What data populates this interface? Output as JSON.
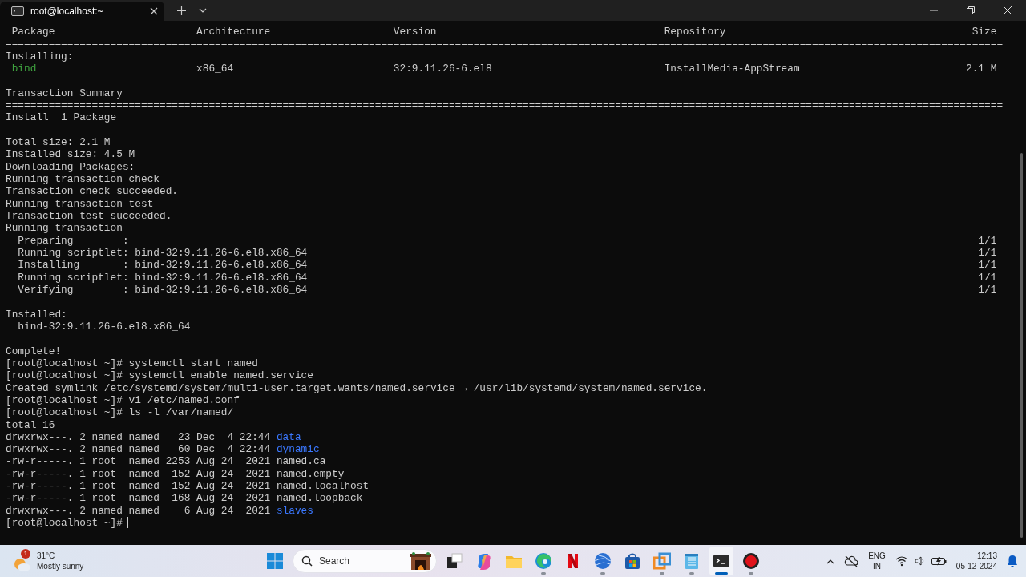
{
  "tabs": [
    {
      "title": "root@localhost:~",
      "selected": true
    }
  ],
  "terminal": {
    "lines": [
      {
        "kind": "table_header",
        "cells": [
          "Package",
          "Architecture",
          "Version",
          "Repository",
          "Size"
        ]
      },
      {
        "kind": "rule",
        "text": "=================================================================================================================================================================="
      },
      {
        "kind": "text",
        "text": "Installing:"
      },
      {
        "kind": "table_row",
        "cells": [
          "bind",
          "x86_64",
          "32:9.11.26-6.el8",
          "InstallMedia-AppStream",
          "2.1 M"
        ]
      },
      {
        "kind": "blank"
      },
      {
        "kind": "text",
        "text": "Transaction Summary"
      },
      {
        "kind": "rule",
        "text": "=================================================================================================================================================================="
      },
      {
        "kind": "text",
        "text": "Install  1 Package"
      },
      {
        "kind": "blank"
      },
      {
        "kind": "text",
        "text": "Total size: 2.1 M"
      },
      {
        "kind": "text",
        "text": "Installed size: 4.5 M"
      },
      {
        "kind": "text",
        "text": "Downloading Packages:"
      },
      {
        "kind": "text",
        "text": "Running transaction check"
      },
      {
        "kind": "text",
        "text": "Transaction check succeeded."
      },
      {
        "kind": "text",
        "text": "Running transaction test"
      },
      {
        "kind": "text",
        "text": "Transaction test succeeded."
      },
      {
        "kind": "text",
        "text": "Running transaction"
      },
      {
        "kind": "progress",
        "step": "Preparing        :",
        "count": "1/1"
      },
      {
        "kind": "progress",
        "step": "Running scriptlet: bind-32:9.11.26-6.el8.x86_64",
        "count": "1/1"
      },
      {
        "kind": "progress",
        "step": "Installing       : bind-32:9.11.26-6.el8.x86_64",
        "count": "1/1"
      },
      {
        "kind": "progress",
        "step": "Running scriptlet: bind-32:9.11.26-6.el8.x86_64",
        "count": "1/1"
      },
      {
        "kind": "progress",
        "step": "Verifying        : bind-32:9.11.26-6.el8.x86_64",
        "count": "1/1"
      },
      {
        "kind": "blank"
      },
      {
        "kind": "text",
        "text": "Installed:"
      },
      {
        "kind": "text",
        "text": "  bind-32:9.11.26-6.el8.x86_64"
      },
      {
        "kind": "blank"
      },
      {
        "kind": "text",
        "text": "Complete!"
      },
      {
        "kind": "prompt",
        "text": "[root@localhost ~]# systemctl start named"
      },
      {
        "kind": "prompt",
        "text": "[root@localhost ~]# systemctl enable named.service"
      },
      {
        "kind": "text",
        "text": "Created symlink /etc/systemd/system/multi-user.target.wants/named.service → /usr/lib/systemd/system/named.service."
      },
      {
        "kind": "prompt",
        "text": "[root@localhost ~]# vi /etc/named.conf"
      },
      {
        "kind": "prompt",
        "text": "[root@localhost ~]# ls -l /var/named/"
      },
      {
        "kind": "text",
        "text": "total 16"
      },
      {
        "kind": "ls",
        "details": "drwxrwx---. 2 named named   23 Dec  4 22:44",
        "name": "data",
        "directory": true
      },
      {
        "kind": "ls",
        "details": "drwxrwx---. 2 named named   60 Dec  4 22:44",
        "name": "dynamic",
        "directory": true
      },
      {
        "kind": "ls",
        "details": "-rw-r-----. 1 root  named 2253 Aug 24  2021",
        "name": "named.ca",
        "directory": false
      },
      {
        "kind": "ls",
        "details": "-rw-r-----. 1 root  named  152 Aug 24  2021",
        "name": "named.empty",
        "directory": false
      },
      {
        "kind": "ls",
        "details": "-rw-r-----. 1 root  named  152 Aug 24  2021",
        "name": "named.localhost",
        "directory": false
      },
      {
        "kind": "ls",
        "details": "-rw-r-----. 1 root  named  168 Aug 24  2021",
        "name": "named.loopback",
        "directory": false
      },
      {
        "kind": "ls",
        "details": "drwxrwx---. 2 named named    6 Aug 24  2021",
        "name": "slaves",
        "directory": true
      },
      {
        "kind": "prompt",
        "text": "[root@localhost ~]#",
        "cursor": true
      }
    ]
  },
  "taskbar": {
    "weather": {
      "badge": "1",
      "temperature": "31°C",
      "condition": "Mostly sunny"
    },
    "search": {
      "placeholder": "Search"
    },
    "apps": [
      {
        "kind": "taskview",
        "running": false,
        "selected": false
      },
      {
        "kind": "copilot",
        "running": false,
        "selected": false
      },
      {
        "kind": "folder",
        "running": false,
        "selected": false
      },
      {
        "kind": "edge",
        "running": true,
        "selected": false
      },
      {
        "kind": "netflix",
        "running": false,
        "selected": false
      },
      {
        "kind": "globe",
        "running": true,
        "selected": false
      },
      {
        "kind": "store",
        "running": false,
        "selected": false
      },
      {
        "kind": "vm",
        "running": true,
        "selected": false
      },
      {
        "kind": "notepad",
        "running": true,
        "selected": false
      },
      {
        "kind": "terminal",
        "running": true,
        "selected": true
      },
      {
        "kind": "record",
        "running": true,
        "selected": false
      }
    ],
    "language": [
      "ENG",
      "IN"
    ],
    "time": "12:13",
    "date": "05-12-2024"
  }
}
